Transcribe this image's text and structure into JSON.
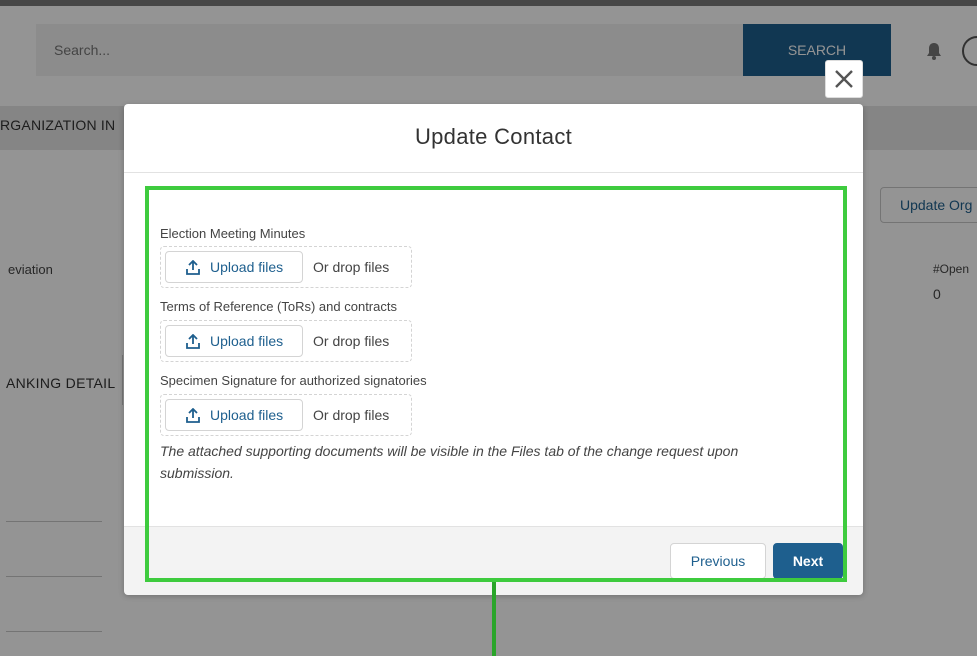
{
  "topbar": {
    "search_placeholder": "Search...",
    "search_button": "SEARCH"
  },
  "background": {
    "tab_label": "RGANIZATION IN",
    "update_org_button": "Update Org",
    "abbreviation_label": "eviation",
    "open_label": "#Open",
    "open_value": "0",
    "banking_label": "ANKING DETAIL"
  },
  "modal": {
    "title": "Update Contact",
    "fields": [
      {
        "label": "Election Meeting Minutes",
        "upload_label": "Upload files",
        "drop_label": "Or drop files"
      },
      {
        "label": "Terms of Reference (ToRs) and contracts",
        "upload_label": "Upload files",
        "drop_label": "Or drop files"
      },
      {
        "label": "Specimen Signature for authorized signatories",
        "upload_label": "Upload files",
        "drop_label": "Or drop files"
      }
    ],
    "note": "The attached supporting documents will be visible in the Files tab of the change request upon submission.",
    "previous_button": "Previous",
    "next_button": "Next"
  },
  "icons": {
    "close": "close-icon",
    "upload": "upload-icon",
    "bell": "bell-icon"
  },
  "colors": {
    "brand": "#1e5f8e",
    "highlight": "#3ecb3e"
  }
}
